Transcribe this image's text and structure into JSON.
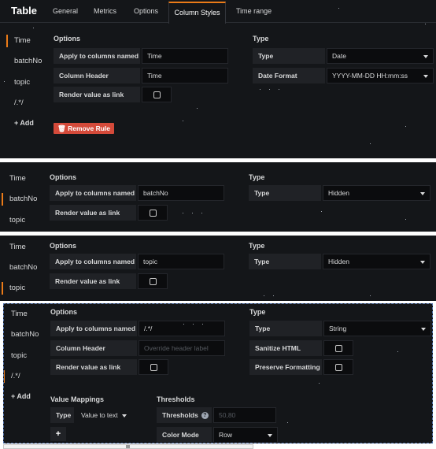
{
  "app": {
    "title": "Table"
  },
  "tabs": [
    {
      "label": "General"
    },
    {
      "label": "Metrics"
    },
    {
      "label": "Options"
    },
    {
      "label": "Column Styles"
    },
    {
      "label": "Time range"
    }
  ],
  "sidebar": {
    "items": [
      "Time",
      "batchNo",
      "topic",
      "/.*/"
    ],
    "add_label": "+ Add"
  },
  "sections": {
    "options": "Options",
    "type": "Type",
    "value_mappings": "Value Mappings",
    "thresholds": "Thresholds"
  },
  "labels": {
    "apply": "Apply to columns named",
    "column_header": "Column Header",
    "render_link": "Render value as link",
    "type": "Type",
    "date_format": "Date Format",
    "sanitize": "Sanitize HTML",
    "preserve": "Preserve Formatting",
    "thresholds": "Thresholds",
    "color_mode": "Color Mode"
  },
  "rule1": {
    "apply_value": "Time",
    "header_value": "Time",
    "type_value": "Date",
    "date_format_value": "YYYY-MM-DD HH:mm:ss",
    "remove_label": "Remove Rule"
  },
  "rule2": {
    "apply_value": "batchNo",
    "type_value": "Hidden"
  },
  "rule3": {
    "apply_value": "topic",
    "type_value": "Hidden"
  },
  "rule4": {
    "apply_value": "/.*/",
    "header_placeholder": "Override header label",
    "type_value": "String",
    "mapping_type_label": "Type",
    "mapping_type_value": "Value to text",
    "thresholds_placeholder": "50,80",
    "color_mode_value": "Row",
    "add_mapping_label": "+",
    "info_glyph": "?"
  },
  "colors": {
    "accent": "#eb7b18",
    "danger": "#d44a3a",
    "panel_bg": "#141619",
    "field_bg": "#0b0c0e",
    "label_bg": "#202226"
  }
}
